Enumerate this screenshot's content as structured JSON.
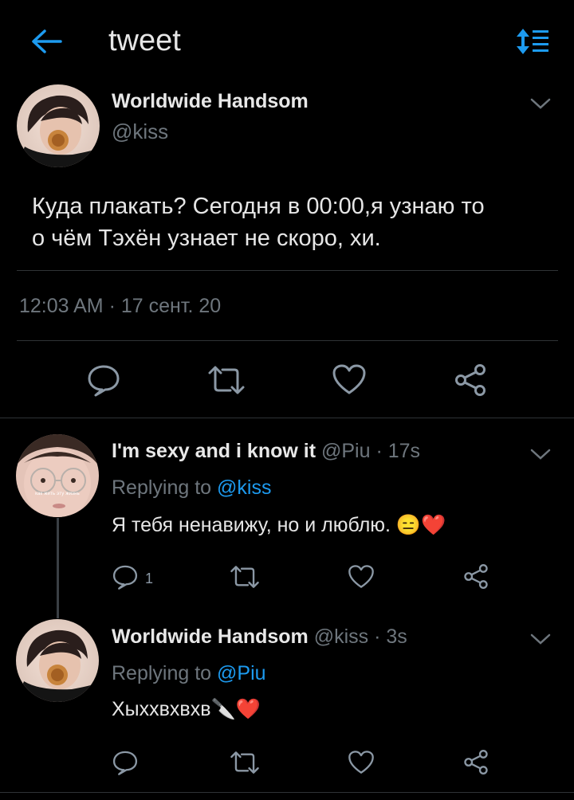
{
  "header": {
    "title": "tweet",
    "back_icon": "arrow-left-icon",
    "sort_icon": "sort-list-icon"
  },
  "main_tweet": {
    "display_name": "Worldwide Handsom",
    "handle": "@kiss",
    "text_line1": "Куда плакать? Сегодня в 00:00,я узнаю то",
    "text_line2": "о чём Тэхён узнает не скоро, хи.",
    "timestamp": "12:03 AM · 17 сент. 20"
  },
  "replies": [
    {
      "display_name": "I'm sexy and i know it",
      "handle_time": "@Piu · 17s",
      "replying_prefix": "Replying to ",
      "replying_handle": "@kiss",
      "text": "Я тебя ненавижу, но и люблю. 😑❤️",
      "reply_count": "1",
      "avatar_caption": "как жить эту жизнь"
    },
    {
      "display_name": "Worldwide Handsom",
      "handle_time": "@kiss · 3s",
      "replying_prefix": "Replying to ",
      "replying_handle": "@Piu",
      "text": "Хыххвхвхв🔪❤️"
    }
  ],
  "colors": {
    "background": "#000000",
    "accent": "#1d9bf0",
    "muted": "#6e767d",
    "divider": "#2f3336"
  }
}
